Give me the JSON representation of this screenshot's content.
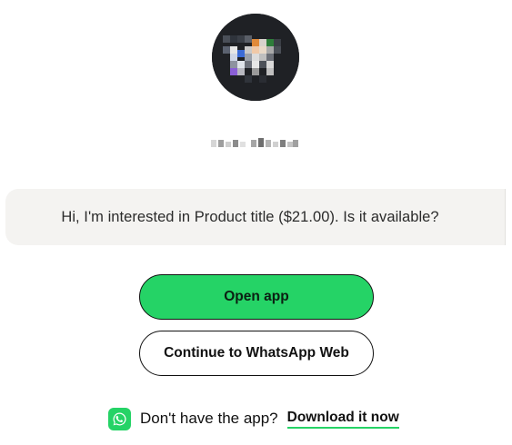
{
  "profile": {
    "avatar_icon": "profile-avatar-pixelated",
    "name_icon": "pixelated-name-placeholder"
  },
  "message": {
    "text": "Hi, I'm interested in Product title ($21.00). Is it available?"
  },
  "actions": {
    "open_app_label": "Open app",
    "web_label": "Continue to WhatsApp Web"
  },
  "footer": {
    "icon": "whatsapp-icon",
    "prompt": "Don't have the app?",
    "download_label": "Download it now"
  },
  "colors": {
    "brand_green": "#25d366",
    "bubble_bg": "#f4f3f1",
    "text": "#111111"
  }
}
